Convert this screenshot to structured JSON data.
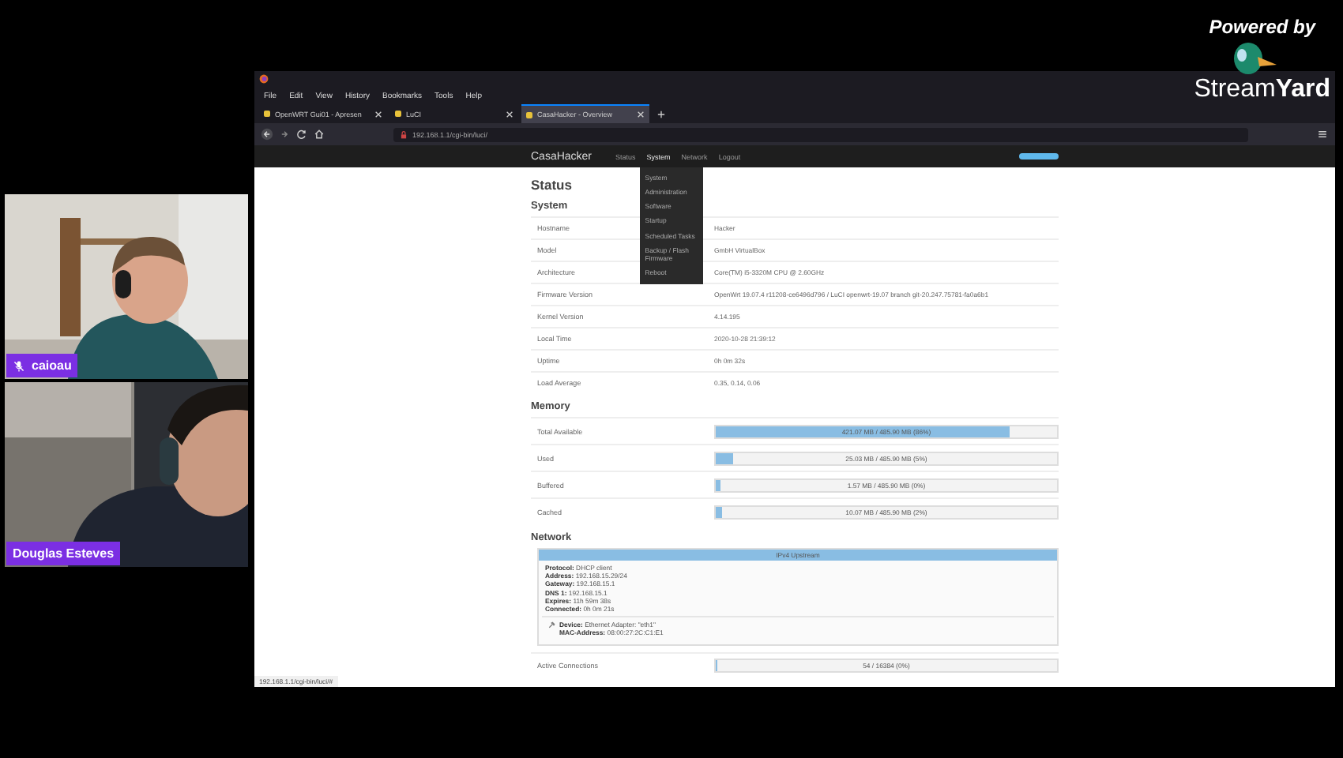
{
  "stream": {
    "powered_by": "Powered by",
    "brand": "Stream**Yard**",
    "participants": [
      {
        "name": "caioau",
        "muted": true
      },
      {
        "name": "Douglas Esteves",
        "muted": false
      }
    ]
  },
  "browser": {
    "menu": [
      "File",
      "Edit",
      "View",
      "History",
      "Bookmarks",
      "Tools",
      "Help"
    ],
    "tabs": [
      {
        "label": "OpenWRT Gui01 - Apresen",
        "selected": false
      },
      {
        "label": "LuCI",
        "selected": false
      },
      {
        "label": "CasaHacker - Overview",
        "selected": true
      }
    ],
    "url": "192.168.1.1/cgi-bin/luci/",
    "status_url": "192.168.1.1/cgi-bin/luci/#"
  },
  "page": {
    "brand": "CasaHacker",
    "nav": [
      {
        "label": "Status",
        "expanded": false
      },
      {
        "label": "System",
        "expanded": true,
        "children": [
          "System",
          "Administration",
          "Software",
          "Startup",
          "Scheduled Tasks",
          "Backup / Flash Firmware",
          "Reboot"
        ]
      },
      {
        "label": "Network",
        "expanded": false
      },
      {
        "label": "Logout",
        "expanded": false
      }
    ],
    "title": "Status",
    "system": {
      "heading": "System",
      "rows": [
        {
          "label": "Hostname",
          "value": "Hacker"
        },
        {
          "label": "Model",
          "value": "GmbH VirtualBox"
        },
        {
          "label": "Architecture",
          "value": "Core(TM) i5-3320M CPU @ 2.60GHz"
        },
        {
          "label": "Firmware Version",
          "value": "OpenWrt 19.07.4 r11208-ce6496d796 / LuCI openwrt-19.07 branch git-20.247.75781-fa0a6b1"
        },
        {
          "label": "Kernel Version",
          "value": "4.14.195"
        },
        {
          "label": "Local Time",
          "value": "2020-10-28 21:39:12"
        },
        {
          "label": "Uptime",
          "value": "0h 0m 32s"
        },
        {
          "label": "Load Average",
          "value": "0.35, 0.14, 0.06"
        }
      ]
    },
    "memory": {
      "heading": "Memory",
      "rows": [
        {
          "label": "Total Available",
          "value": "421.07 MB / 485.90 MB (86%)",
          "level": 0.86
        },
        {
          "label": "Used",
          "value": "25.03 MB / 485.90 MB (5%)",
          "level": 0.05
        },
        {
          "label": "Buffered",
          "value": "1.57 MB / 485.90 MB (0%)",
          "level": 0.0
        },
        {
          "label": "Cached",
          "value": "10.07 MB / 485.90 MB (2%)",
          "level": 0.02
        }
      ]
    },
    "network": {
      "heading": "Network",
      "panel_title": "IPv4 Upstream",
      "lines": [
        {
          "label": "Protocol:",
          "value": "DHCP client"
        },
        {
          "label": "Address:",
          "value": "192.168.15.29/24"
        },
        {
          "label": "Gateway:",
          "value": "192.168.15.1"
        },
        {
          "label": "DNS 1:",
          "value": "192.168.15.1"
        },
        {
          "label": "Expires:",
          "value": "11h 59m 38s"
        },
        {
          "label": "Connected:",
          "value": "0h 0m 21s"
        }
      ],
      "device_lines": [
        {
          "label": "Device:",
          "value": "Ethernet Adapter: \"eth1\""
        },
        {
          "label": "MAC-Address:",
          "value": "08:00:27:2C:C1:E1"
        }
      ],
      "rows": [
        {
          "label": "Active Connections",
          "value": "54 / 16384 (0%)",
          "level": 0.003
        }
      ]
    }
  }
}
